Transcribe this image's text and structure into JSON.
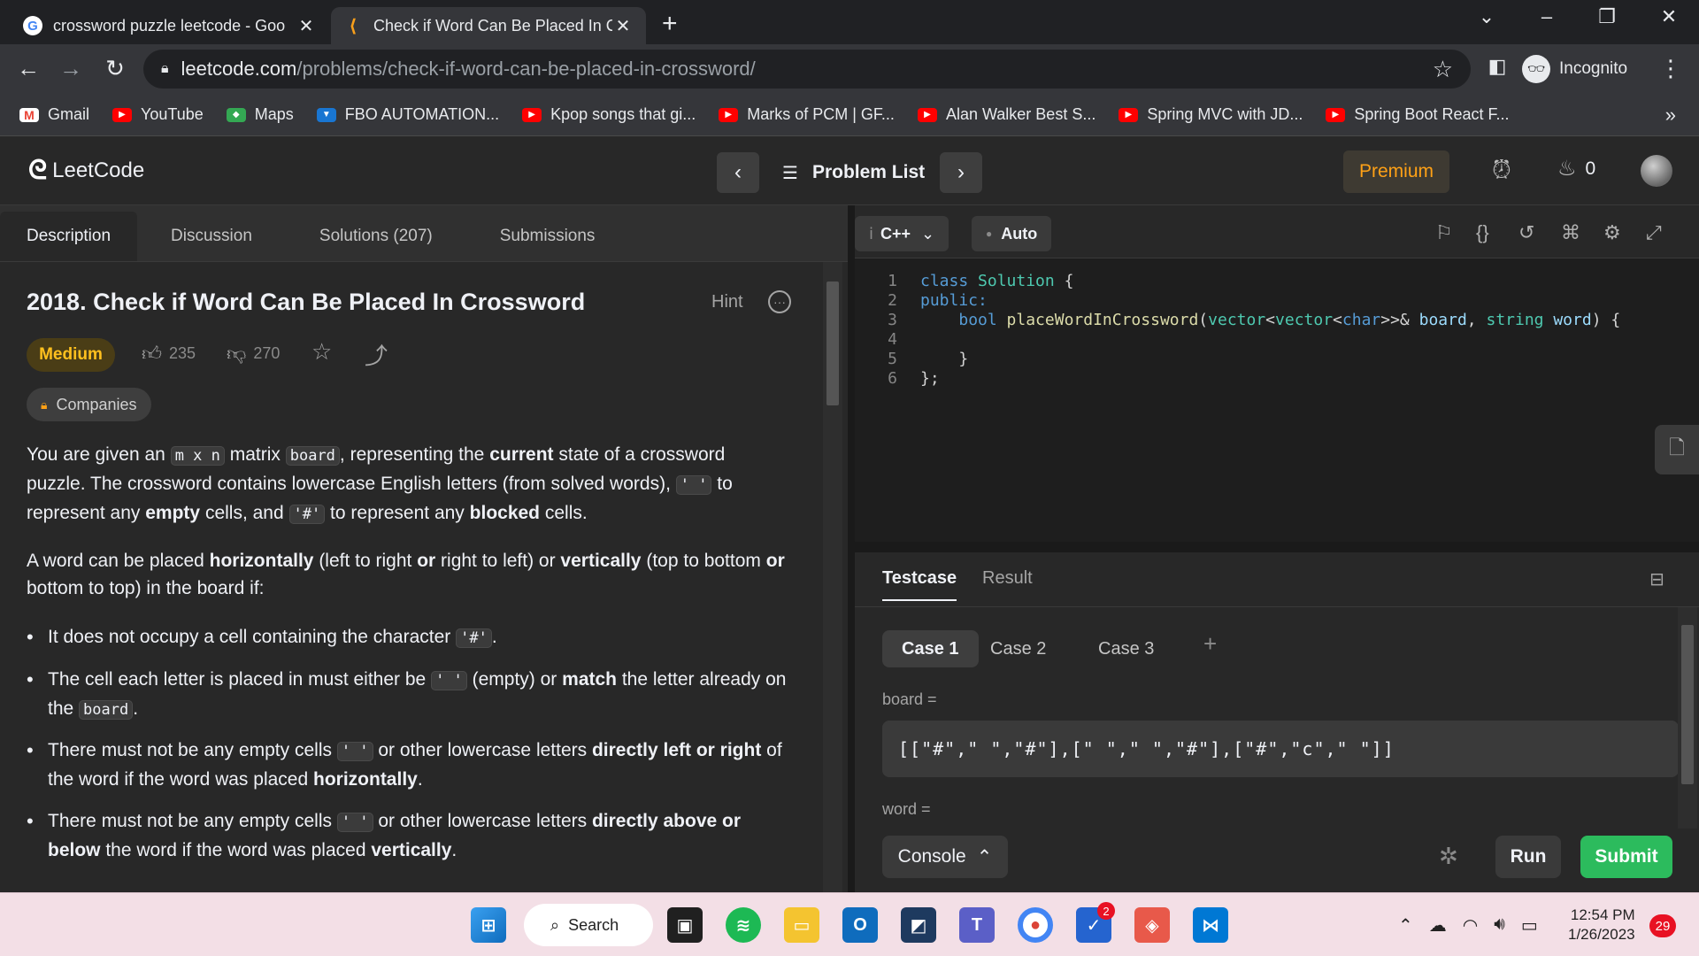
{
  "browser": {
    "tabs": [
      {
        "title": "crossword puzzle leetcode - Goo",
        "favicon": "google-icon"
      },
      {
        "title": "Check if Word Can Be Placed In C",
        "favicon": "leetcode-icon"
      }
    ],
    "url_host": "leetcode.com",
    "url_path": "/problems/check-if-word-can-be-placed-in-crossword/",
    "profile_label": "Incognito",
    "bookmarks": [
      {
        "label": "Gmail",
        "icon": "gmail-icon"
      },
      {
        "label": "YouTube",
        "icon": "youtube-icon"
      },
      {
        "label": "Maps",
        "icon": "maps-icon"
      },
      {
        "label": "FBO AUTOMATION...",
        "icon": "bookmark-icon"
      },
      {
        "label": "Kpop songs that gi...",
        "icon": "youtube-icon"
      },
      {
        "label": "Marks of PCM | GF...",
        "icon": "youtube-icon"
      },
      {
        "label": "Alan Walker Best S...",
        "icon": "youtube-icon"
      },
      {
        "label": "Spring MVC with JD...",
        "icon": "youtube-icon"
      },
      {
        "label": "Spring Boot React F...",
        "icon": "youtube-icon"
      }
    ]
  },
  "nav": {
    "logo": "LeetCode",
    "problem_list": "Problem List",
    "premium": "Premium",
    "streak": "0"
  },
  "left": {
    "tabs": [
      "Description",
      "Discussion",
      "Solutions (207)",
      "Submissions"
    ],
    "title": "2018. Check if Word Can Be Placed In Crossword",
    "hint": "Hint",
    "difficulty": "Medium",
    "likes": "235",
    "dislikes": "270",
    "companies": "Companies",
    "p1": {
      "a": "You are given an ",
      "c1": "m x n",
      "b": " matrix ",
      "c2": "board",
      "c": ", representing the ",
      "d": "current",
      "e": " state of a crossword puzzle. The crossword contains lowercase English letters (from solved words), ",
      "c3": "' '",
      "f": " to represent any ",
      "g": "empty",
      "h": " cells, and ",
      "c4": "'#'",
      "i": " to represent any ",
      "j": "blocked",
      "k": " cells."
    },
    "p2": {
      "a": "A word can be placed ",
      "b": "horizontally",
      "c": " (left to right ",
      "d": "or",
      "e": " right to left) or ",
      "f": "vertically",
      "g": " (top to bottom ",
      "h": "or",
      "i": " bottom to top) in the board if:"
    },
    "b1": {
      "a": "It does not occupy a cell containing the character ",
      "c": "'#'",
      "b": "."
    },
    "b2": {
      "a": "The cell each letter is placed in must either be ",
      "c1": "' '",
      "b": " (empty) or ",
      "d": "match",
      "e": " the letter already on the ",
      "c2": "board",
      "f": "."
    },
    "b3": {
      "a": "There must not be any empty cells ",
      "c": "' '",
      "b": " or other lowercase letters ",
      "d": "directly left or right",
      "e": " of the word if the word was placed ",
      "f": "horizontally",
      "g": "."
    },
    "b4": {
      "a": "There must not be any empty cells ",
      "c": "' '",
      "b": " or other lowercase letters ",
      "d": "directly above or below",
      "e": " the word if the word was placed ",
      "f": "vertically",
      "g": "."
    }
  },
  "editor": {
    "language": "C++",
    "mode": "Auto",
    "lines": [
      {
        "n": "1",
        "tokens": [
          [
            "kw",
            "class "
          ],
          [
            "ty",
            "Solution"
          ],
          [
            "",
            " {"
          ]
        ]
      },
      {
        "n": "2",
        "tokens": [
          [
            "kw",
            "public:"
          ]
        ]
      },
      {
        "n": "3",
        "tokens": [
          [
            "",
            "    "
          ],
          [
            "kw",
            "bool "
          ],
          [
            "fn",
            "placeWordInCrossword"
          ],
          [
            "",
            "("
          ],
          [
            "ty",
            "vector"
          ],
          [
            "",
            "<"
          ],
          [
            "ty",
            "vector"
          ],
          [
            "",
            "<"
          ],
          [
            "kw",
            "char"
          ],
          [
            "",
            ">>& "
          ],
          [
            "va",
            "board"
          ],
          [
            "",
            ", "
          ],
          [
            "ty",
            "string "
          ],
          [
            "va",
            "word"
          ],
          [
            "",
            ") {"
          ]
        ]
      },
      {
        "n": "4",
        "tokens": [
          [
            "",
            ""
          ]
        ]
      },
      {
        "n": "5",
        "tokens": [
          [
            "",
            "    }"
          ]
        ]
      },
      {
        "n": "6",
        "tokens": [
          [
            "",
            "};"
          ]
        ]
      }
    ]
  },
  "testpanel": {
    "tabs": [
      "Testcase",
      "Result"
    ],
    "cases": [
      "Case 1",
      "Case 2",
      "Case 3"
    ],
    "board_label": "board =",
    "board_value": "[[\"#\",\" \",\"#\"],[\" \",\" \",\"#\"],[\"#\",\"c\",\" \"]]",
    "word_label": "word =",
    "console": "Console",
    "run": "Run",
    "submit": "Submit"
  },
  "taskbar": {
    "search": "Search",
    "time": "12:54 PM",
    "date": "1/26/2023",
    "notifications": "29",
    "todo_badge": "2"
  }
}
